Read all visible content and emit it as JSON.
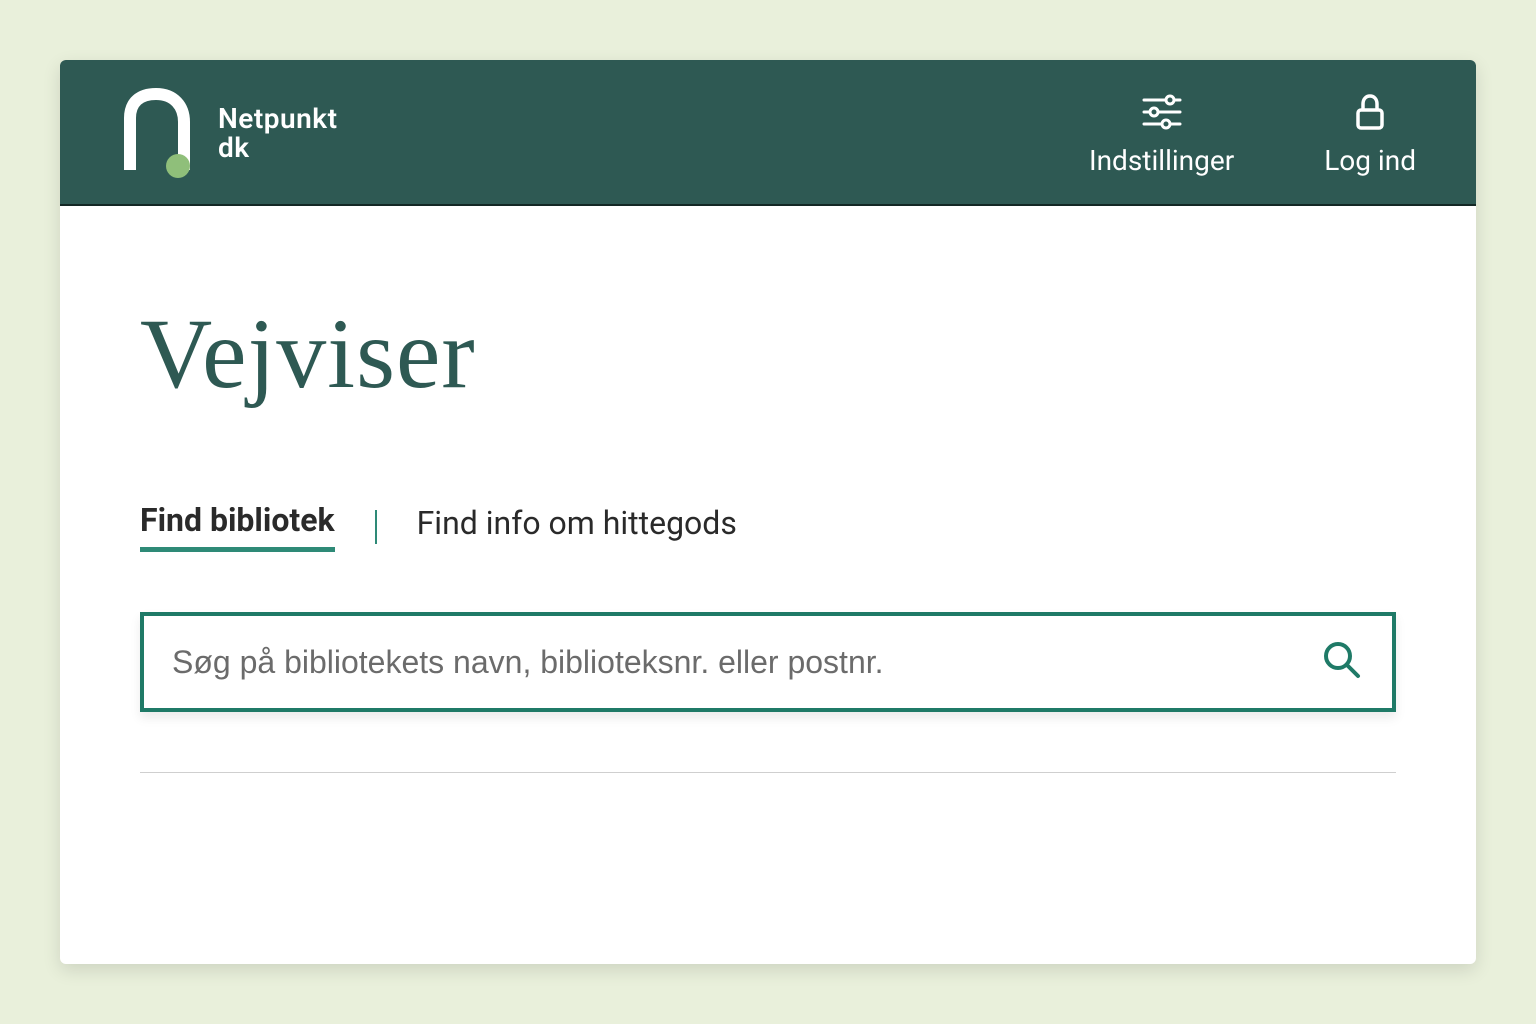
{
  "brand": {
    "line1": "Netpunkt",
    "line2": "dk"
  },
  "header": {
    "settings_label": "Indstillinger",
    "login_label": "Log ind"
  },
  "main": {
    "title": "Vejviser",
    "tabs": [
      {
        "label": "Find bibliotek",
        "active": true
      },
      {
        "label": "Find info om hittegods",
        "active": false
      }
    ],
    "search": {
      "placeholder": "Søg på bibliotekets navn, biblioteksnr. eller postnr."
    }
  },
  "colors": {
    "header_bg": "#2e5953",
    "accent": "#1f7a67",
    "page_bg": "#e9f0db"
  }
}
